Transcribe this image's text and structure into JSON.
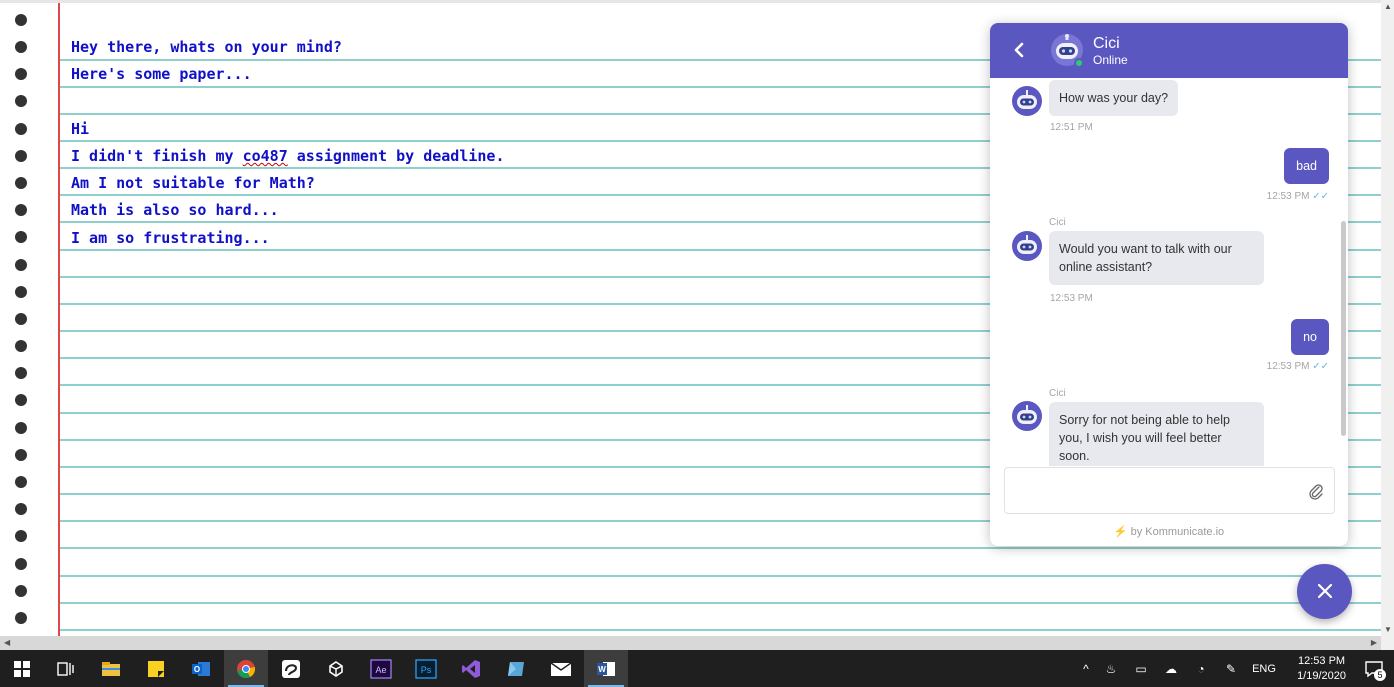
{
  "note": {
    "lines": [
      "Hey there, whats on your mind?",
      "Here's some paper...",
      "",
      "Hi",
      "I didn't finish my co487 assignment by deadline.",
      "Am I not suitable for Math?",
      "Math is also so hard...",
      "I am so frustrating..."
    ],
    "line4_parts": {
      "a": "I didn't finish my ",
      "b": "co487",
      "c": " assignment by deadline."
    }
  },
  "chat": {
    "agent_name": "Cici",
    "agent_status": "Online",
    "messages": [
      {
        "from": "bot",
        "text": "How was your day?",
        "time": "12:51 PM"
      },
      {
        "from": "user",
        "text": "bad",
        "time": "12:53 PM"
      },
      {
        "from": "bot",
        "sender": "Cici",
        "text": "Would you want to talk with our online assistant?",
        "time": "12:53 PM"
      },
      {
        "from": "user",
        "text": "no",
        "time": "12:53 PM"
      },
      {
        "from": "bot",
        "sender": "Cici",
        "text": "Sorry for not being able to help you, I wish you will feel better soon.",
        "time": ""
      }
    ],
    "input_placeholder": "",
    "powered_by": "by Kommunicate.io",
    "accent": "#5b57c0"
  },
  "taskbar": {
    "time": "12:53 PM",
    "date": "1/19/2020",
    "language": "ENG",
    "notification_count": "5",
    "apps": [
      "start",
      "task-view",
      "file-explorer",
      "sticky-notes",
      "outlook",
      "chrome",
      "app-7",
      "unity",
      "after-effects",
      "photoshop",
      "visual-studio",
      "app-12",
      "mail",
      "word"
    ]
  }
}
